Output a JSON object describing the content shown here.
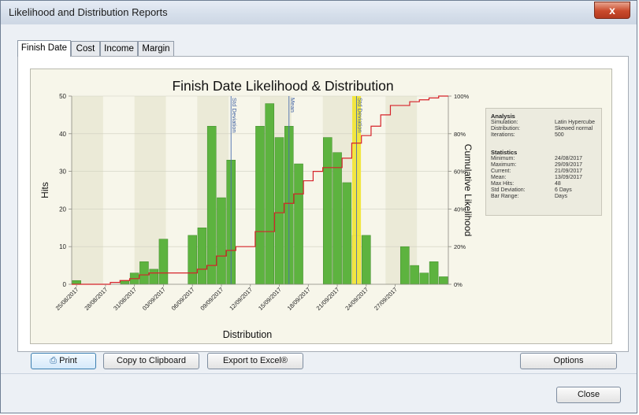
{
  "window": {
    "title": "Likelihood and Distribution Reports",
    "close_glyph": "x"
  },
  "tabs": [
    {
      "label": "Finish Date",
      "active": true
    },
    {
      "label": "Cost",
      "active": false
    },
    {
      "label": "Income",
      "active": false
    },
    {
      "label": "Margin",
      "active": false
    }
  ],
  "chart_data": {
    "type": "bar",
    "title": "Finish Date Likelihood & Distribution",
    "xlabel": "Distribution",
    "ylabel": "Hits",
    "y2label": "Cumulative Likelihood",
    "ylim": [
      0,
      50
    ],
    "y2lim": [
      0,
      100
    ],
    "yticks": [
      "0",
      "10",
      "20",
      "30",
      "40",
      "50"
    ],
    "y2ticks": [
      "0%",
      "20%",
      "40%",
      "60%",
      "80%",
      "100%"
    ],
    "date_labels": [
      "25/08/2017",
      "28/08/2017",
      "31/08/2017",
      "03/09/2017",
      "06/09/2017",
      "09/09/2017",
      "12/09/2017",
      "15/09/2017",
      "18/09/2017",
      "21/09/2017",
      "24/09/2017",
      "27/09/2017"
    ],
    "hits": [
      1,
      0,
      0,
      0,
      0,
      1,
      3,
      6,
      4,
      12,
      0,
      0,
      13,
      15,
      42,
      23,
      33,
      0,
      0,
      42,
      48,
      39,
      42,
      32,
      0,
      0,
      39,
      35,
      27,
      13,
      13,
      0,
      0,
      0,
      10,
      5,
      3,
      6,
      2
    ],
    "highlight_index": 29,
    "cumulative": [
      0,
      0,
      0,
      0,
      1,
      2,
      3,
      5,
      6,
      6,
      6,
      6,
      6,
      8,
      10,
      15,
      18,
      20,
      20,
      28,
      28,
      38,
      43,
      48,
      55,
      60,
      62,
      62,
      67,
      75,
      79,
      84,
      90,
      95,
      95,
      97,
      98,
      99,
      100
    ],
    "markers": [
      {
        "label": "Std Deviation",
        "index": 16
      },
      {
        "label": "Mean",
        "index": 22
      },
      {
        "label": "Std Deviation",
        "index": 29
      }
    ],
    "bar_color": "#5db33f",
    "highlight_color": "#f2e641",
    "line_color": "#d6232a",
    "grid": true
  },
  "analysis": {
    "heading": "Analysis",
    "rows": [
      {
        "k": "Simulation:",
        "v": "Latin Hypercube"
      },
      {
        "k": "Distribution:",
        "v": "Skewed normal"
      },
      {
        "k": "Iterations:",
        "v": "500"
      }
    ]
  },
  "statistics": {
    "heading": "Statistics",
    "rows": [
      {
        "k": "Minimum:",
        "v": "24/08/2017"
      },
      {
        "k": "Maximum:",
        "v": "29/09/2017"
      },
      {
        "k": "Current:",
        "v": "21/09/2017"
      },
      {
        "k": "Mean:",
        "v": "13/09/2017"
      },
      {
        "k": "Max Hits:",
        "v": "48"
      },
      {
        "k": "Std Deviation:",
        "v": "6 Days"
      },
      {
        "k": "Bar Range:",
        "v": "Days"
      }
    ]
  },
  "buttons": {
    "print": "Print",
    "copy": "Copy to Clipboard",
    "export": "Export to Excel®",
    "options": "Options",
    "close": "Close"
  }
}
